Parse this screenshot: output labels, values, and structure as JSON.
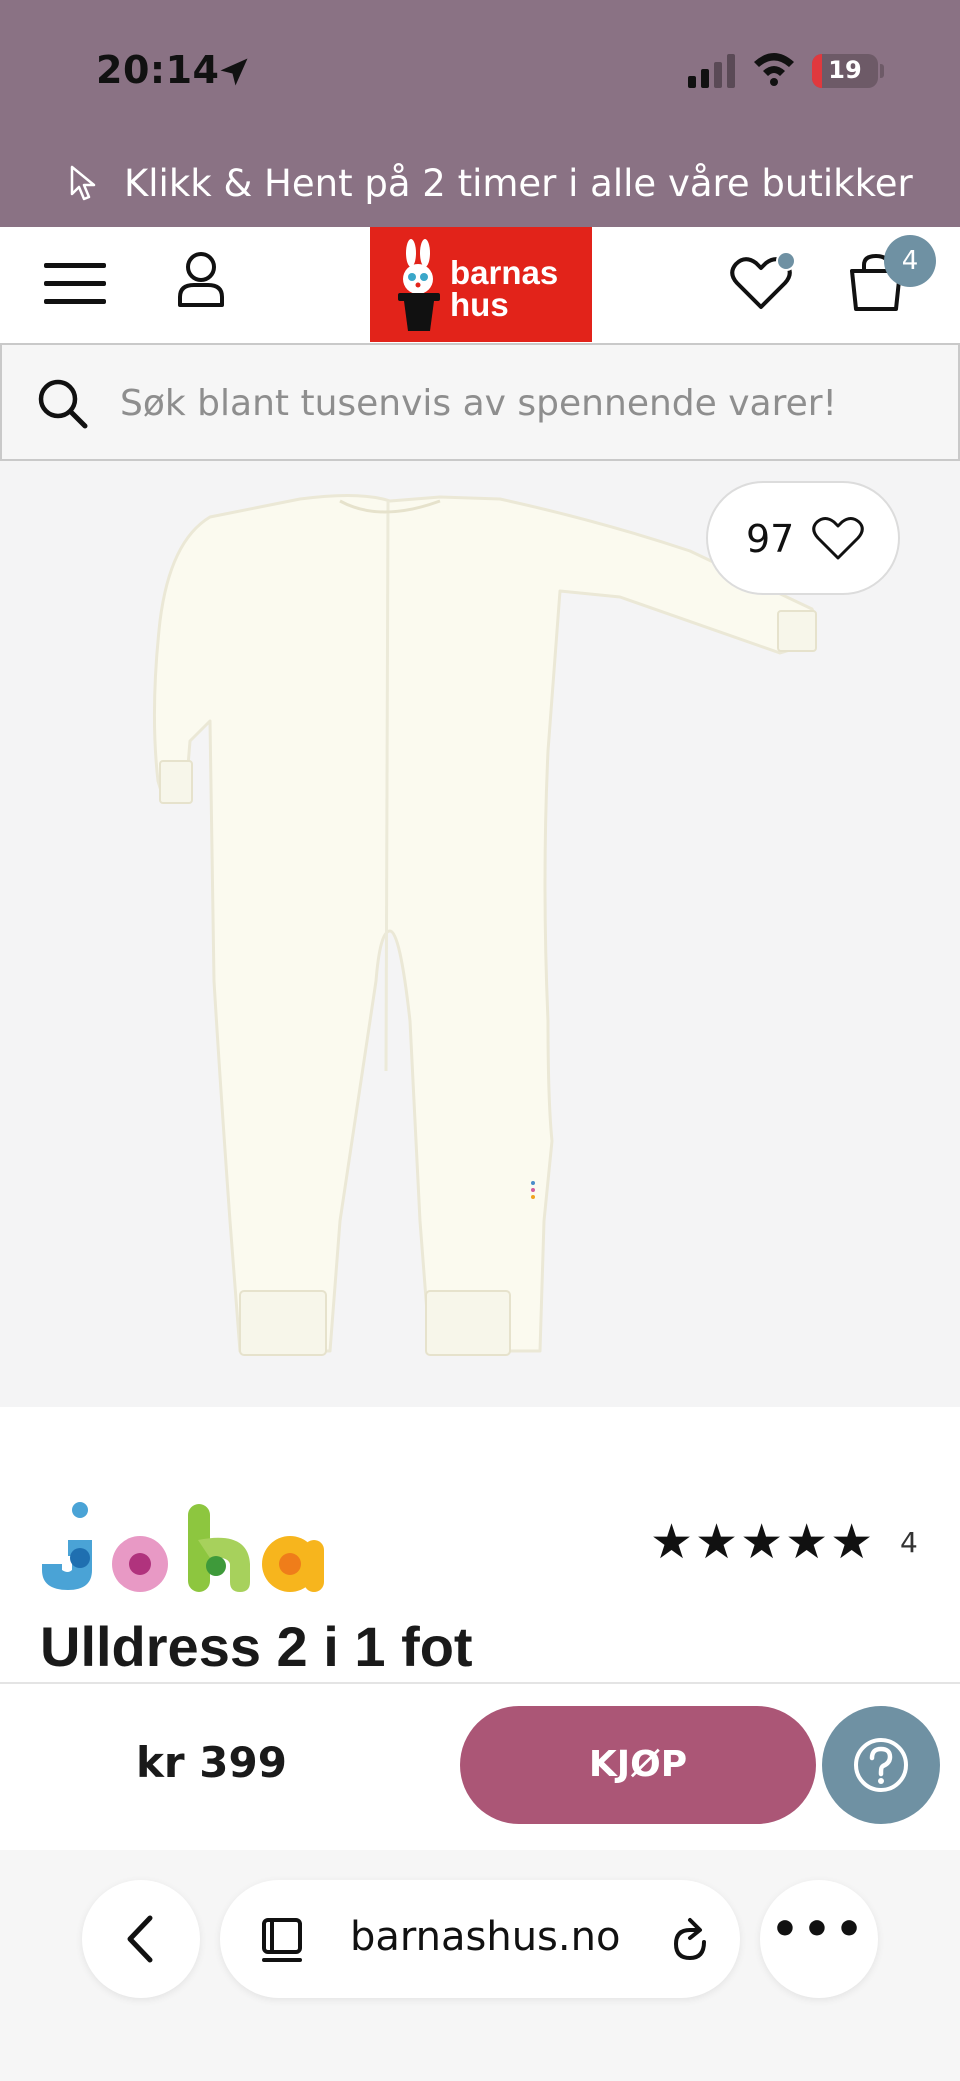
{
  "status_bar": {
    "time": "20:14",
    "battery": "19"
  },
  "promo": {
    "text": "Klikk & Hent på 2 timer i alle våre butikker",
    "icon": "cursor-icon"
  },
  "header": {
    "logo_line1": "barnas",
    "logo_line2": "hus",
    "cart_count": "4",
    "brand_color": "#e2231a"
  },
  "search": {
    "placeholder": "Søk blant tusenvis av spennende varer!"
  },
  "product": {
    "favorites_count": "97",
    "brand": "joha",
    "rating_stars": "★★★★★",
    "review_count": "4",
    "title": "Ulldress 2 i 1 fot",
    "price": "kr 399",
    "buy_label": "KJØP"
  },
  "browser": {
    "url": "barnashus.no"
  },
  "colors": {
    "top_bar": "#8a7284",
    "buy_button": "#ab5676",
    "accent": "#6f91a3"
  }
}
